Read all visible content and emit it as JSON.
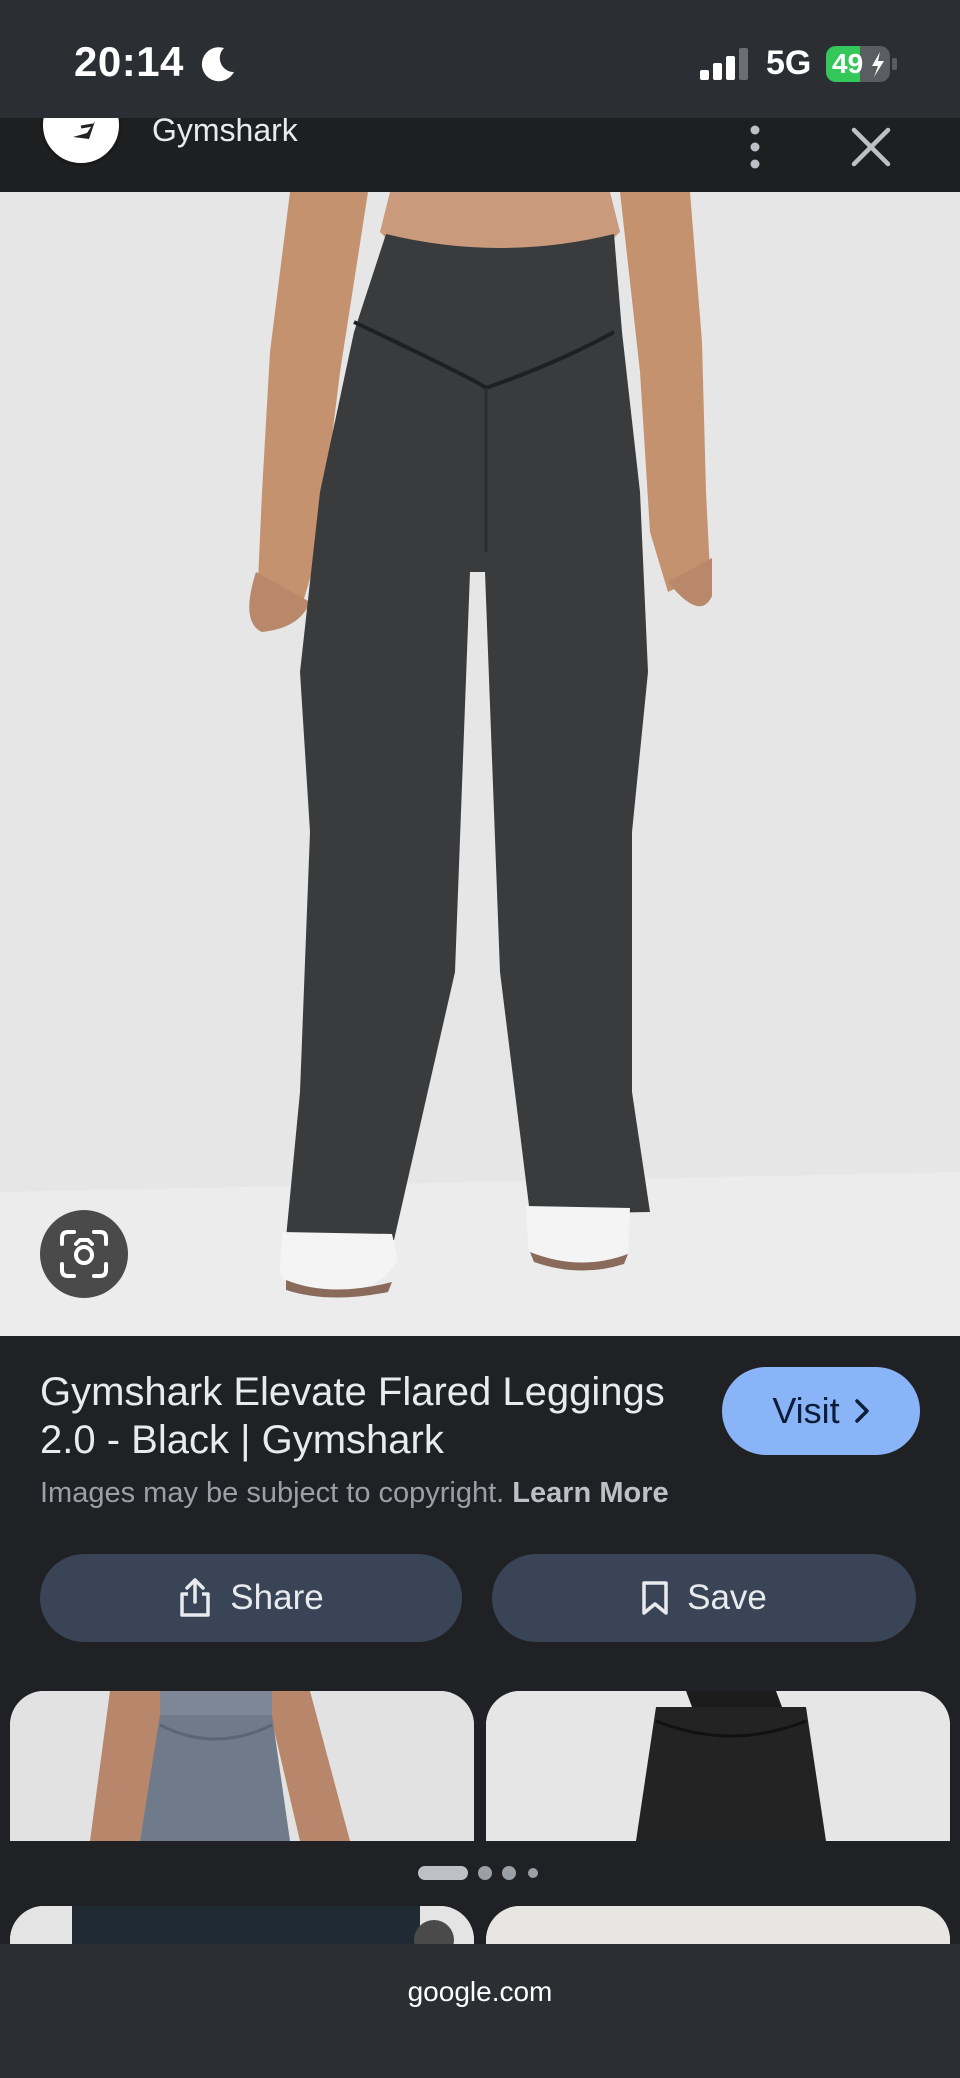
{
  "status_bar": {
    "time": "20:14",
    "network": "5G",
    "battery": "49"
  },
  "header": {
    "site_name": "Gymshark"
  },
  "result": {
    "title": "Gymshark Elevate Flared Leggings 2.0 - Black | Gymshark",
    "visit_label": "Visit",
    "copyright_text": "Images may be subject to copyright.",
    "learn_more_label": "Learn More",
    "share_label": "Share",
    "save_label": "Save"
  },
  "icons": {
    "moon": "moon-icon",
    "signal": "signal-icon",
    "battery": "battery-charging-icon",
    "more": "more-vert-icon",
    "close": "close-icon",
    "lens": "google-lens-icon",
    "share": "share-icon",
    "save": "bookmark-icon",
    "chevron": "chevron-right-icon"
  },
  "colors": {
    "visit_button": "#8ab4f8",
    "action_button": "#394457",
    "battery_fill": "#34c759"
  },
  "carousel": {
    "page_count": 4,
    "active_page": 1
  },
  "footer": {
    "domain": "google.com"
  }
}
